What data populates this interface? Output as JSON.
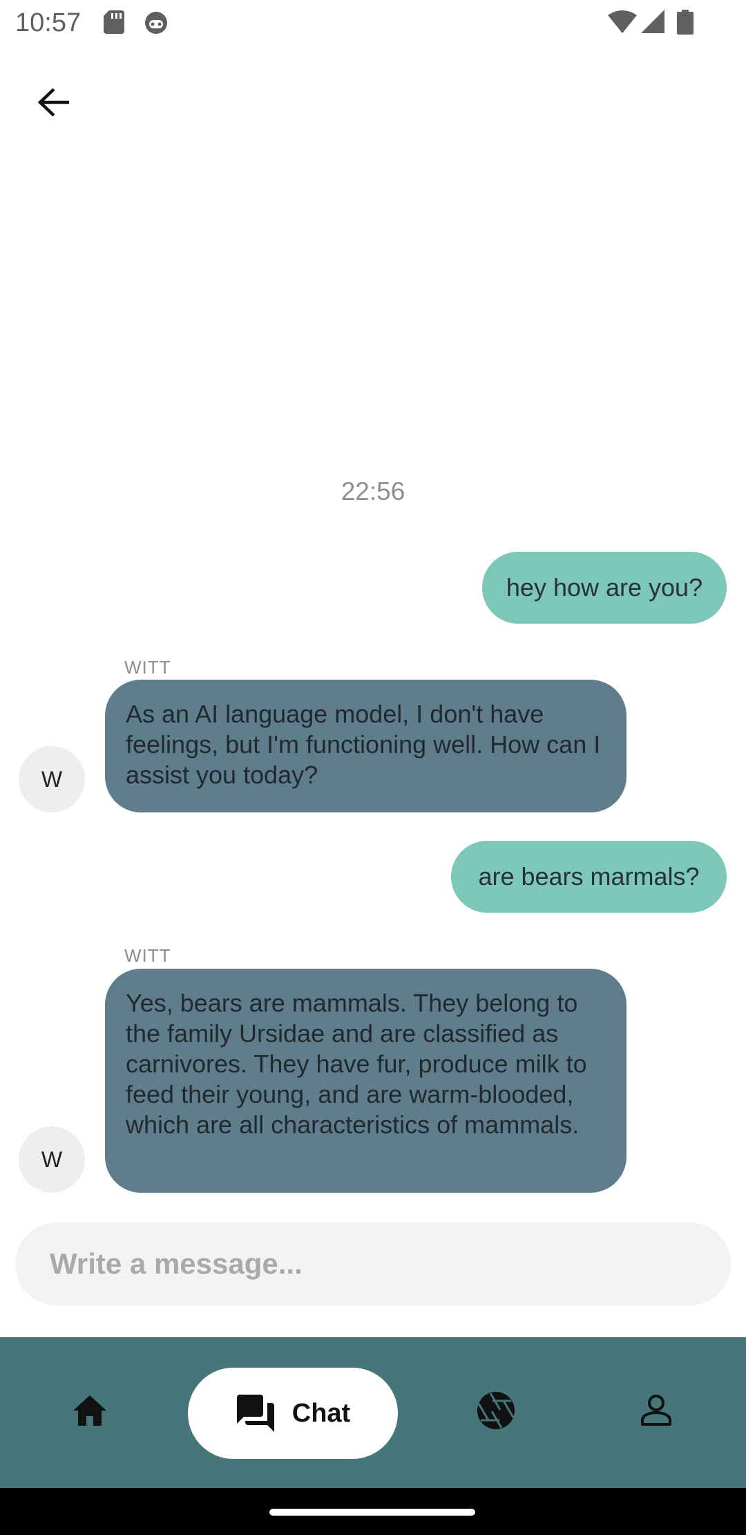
{
  "status_bar": {
    "time": "10:57",
    "icons": [
      "sd-card-icon",
      "robot-icon",
      "wifi-icon",
      "signal-icon",
      "battery-icon"
    ]
  },
  "header": {
    "back_icon": "arrow-back-icon"
  },
  "chat": {
    "timestamp": "22:56",
    "messages": [
      {
        "from": "user",
        "text": "hey how are you?"
      },
      {
        "from": "bot",
        "sender": "WITT",
        "avatar": "W",
        "text": "As an AI language model, I don't have feelings, but I'm functioning well. How can I assist you today?"
      },
      {
        "from": "user",
        "text": "are bears marmals?"
      },
      {
        "from": "bot",
        "sender": "WITT",
        "avatar": "W",
        "text": "Yes, bears are mammals. They belong to the family Ursidae and are classified as carnivores. They have fur, produce milk to feed their young, and are warm-blooded, which are all characteristics of mammals."
      }
    ]
  },
  "composer": {
    "value": "",
    "placeholder": "Write a message..."
  },
  "bottom_nav": {
    "items": [
      {
        "icon": "home-icon",
        "label": ""
      },
      {
        "icon": "chat-icon",
        "label": "Chat",
        "active": true
      },
      {
        "icon": "camera-aperture-icon",
        "label": ""
      },
      {
        "icon": "person-icon",
        "label": ""
      }
    ]
  },
  "colors": {
    "user_bubble": "#7dc6ba",
    "bot_bubble": "#607d8b",
    "nav_background": "#46757a",
    "input_background": "#f3f3f3"
  }
}
